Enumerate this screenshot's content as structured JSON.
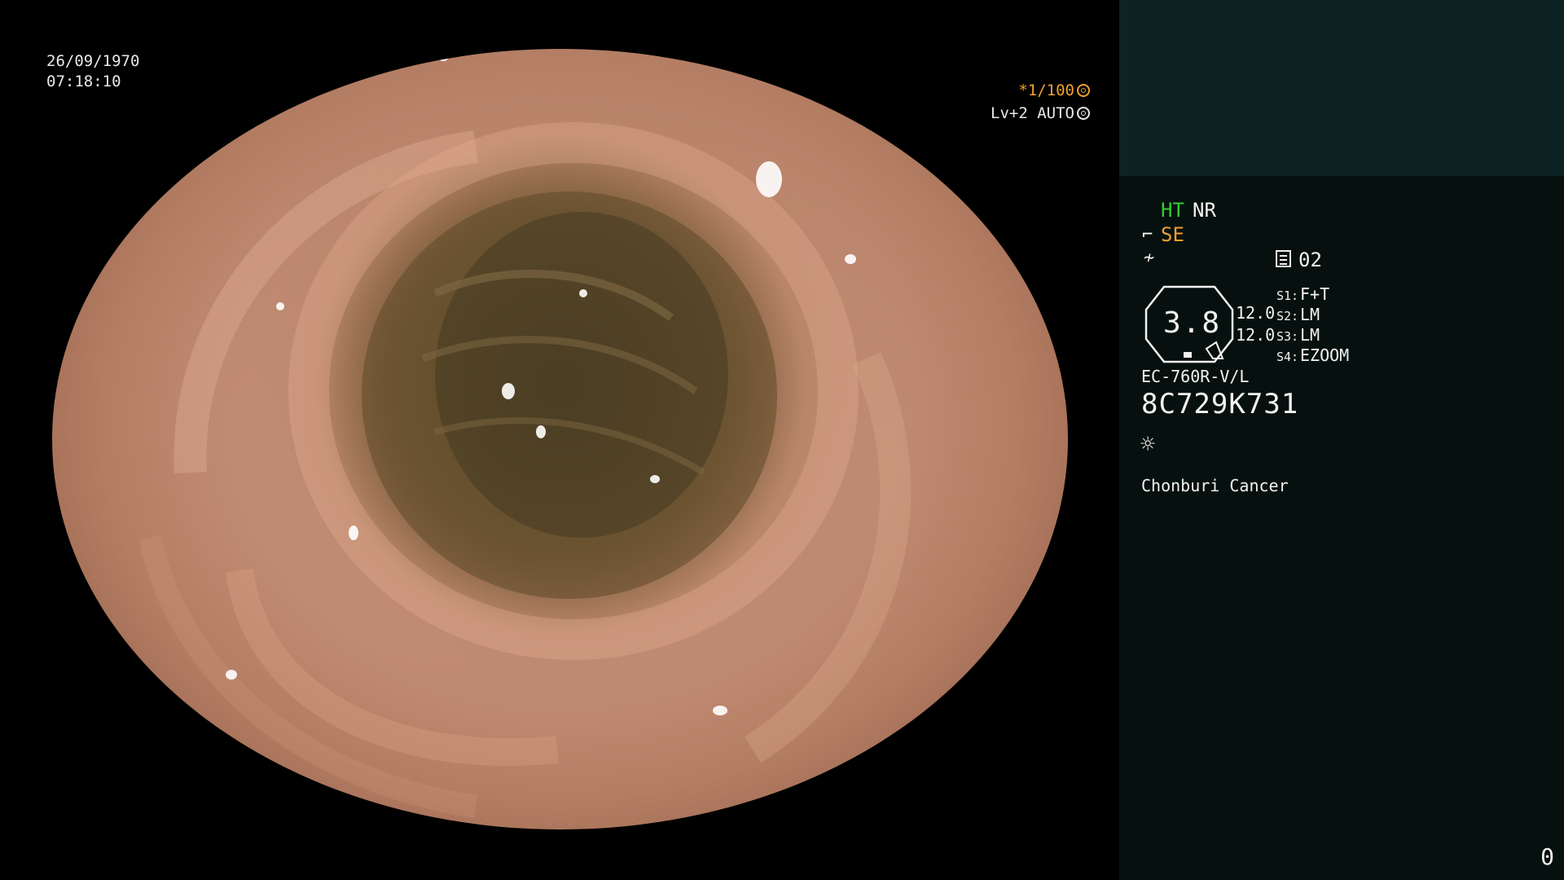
{
  "overlay": {
    "date": "26/09/1970",
    "time": "07:18:10",
    "shutter": "*1/100",
    "shutter_icon": "shutter-icon",
    "level": "Lv+2 AUTO",
    "level_icon": "iris-icon"
  },
  "panel": {
    "ht": "HT",
    "nr": "NR",
    "se": "SE",
    "se_icon": "scope-icon",
    "curve_icon": "curve-icon",
    "profile_icon": "sheet-icon",
    "profile": "02",
    "main_value": "3.8",
    "value_top": "12.0",
    "value_bottom": "12.0",
    "switches": [
      {
        "label": "S1:",
        "value": "F+T"
      },
      {
        "label": "S2:",
        "value": "LM"
      },
      {
        "label": "S3:",
        "value": "LM"
      },
      {
        "label": "S4:",
        "value": "EZOOM"
      }
    ],
    "model": "EC-760R-V/L",
    "serial": "8C729K731",
    "light_icon": "sun-icon",
    "site": "Chonburi Cancer",
    "counter": "0"
  },
  "colors": {
    "accent_green": "#33cc33",
    "accent_orange": "#f0a030",
    "panel_top": "#0d2223",
    "panel_bg": "#06110f"
  }
}
